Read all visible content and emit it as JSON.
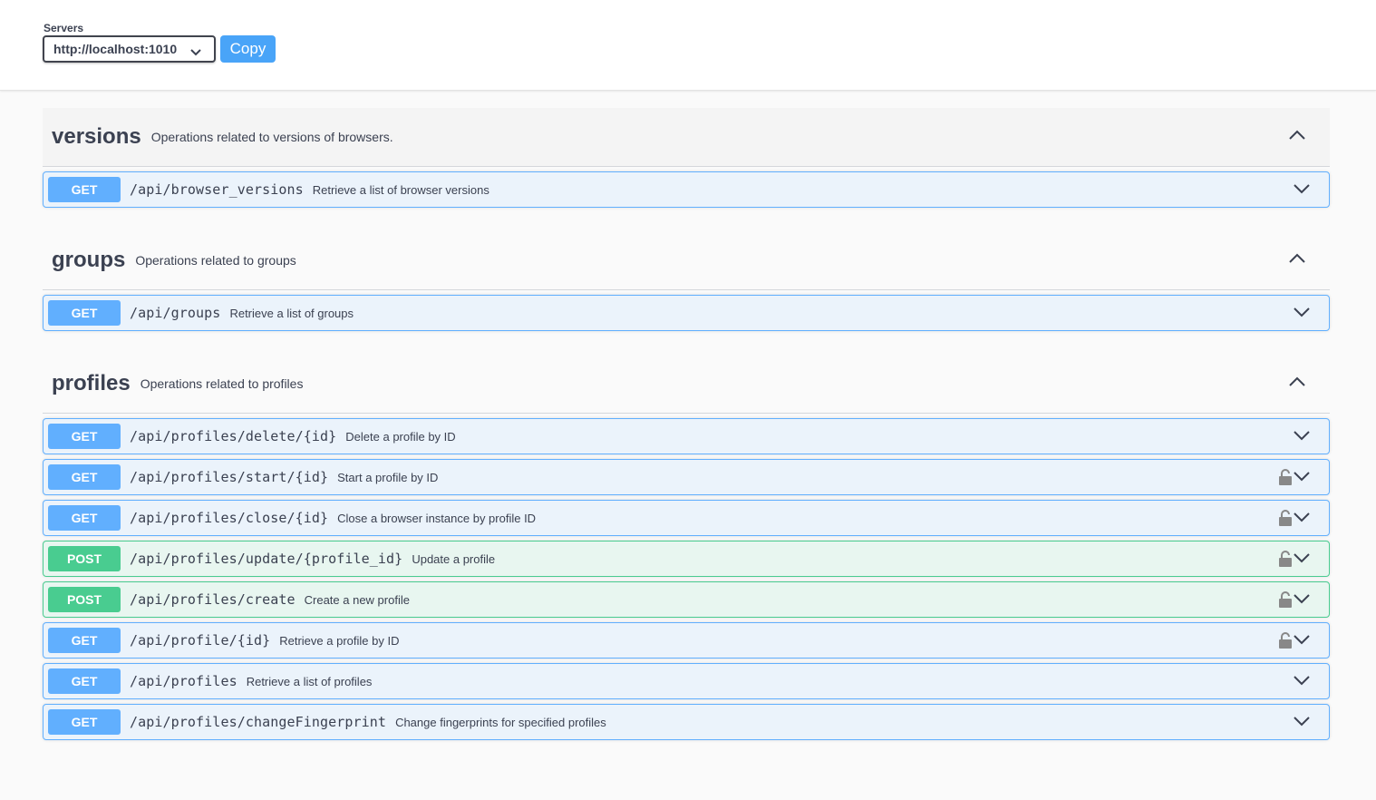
{
  "servers": {
    "label": "Servers",
    "selected": "http://localhost:1010",
    "copy_label": "Copy"
  },
  "icons": {
    "dropdown": "chevron-down-icon",
    "collapse": "chevron-up-icon",
    "expand": "chevron-down-icon",
    "lock": "lock-icon"
  },
  "colors": {
    "get": "#61affe",
    "post": "#49cc90",
    "copy_button": "#49a4f8"
  },
  "tags": [
    {
      "name": "versions",
      "description": "Operations related to versions of browsers.",
      "operations": [
        {
          "method": "GET",
          "path": "/api/browser_versions",
          "summary": "Retrieve a list of browser versions",
          "locked": false
        }
      ]
    },
    {
      "name": "groups",
      "description": "Operations related to groups",
      "operations": [
        {
          "method": "GET",
          "path": "/api/groups",
          "summary": "Retrieve a list of groups",
          "locked": false
        }
      ]
    },
    {
      "name": "profiles",
      "description": "Operations related to profiles",
      "operations": [
        {
          "method": "GET",
          "path": "/api/profiles/delete/{id}",
          "summary": "Delete a profile by ID",
          "locked": false
        },
        {
          "method": "GET",
          "path": "/api/profiles/start/{id}",
          "summary": "Start a profile by ID",
          "locked": true
        },
        {
          "method": "GET",
          "path": "/api/profiles/close/{id}",
          "summary": "Close a browser instance by profile ID",
          "locked": true
        },
        {
          "method": "POST",
          "path": "/api/profiles/update/{profile_id}",
          "summary": "Update a profile",
          "locked": true
        },
        {
          "method": "POST",
          "path": "/api/profiles/create",
          "summary": "Create a new profile",
          "locked": true
        },
        {
          "method": "GET",
          "path": "/api/profile/{id}",
          "summary": "Retrieve a profile by ID",
          "locked": true
        },
        {
          "method": "GET",
          "path": "/api/profiles",
          "summary": "Retrieve a list of profiles",
          "locked": false
        },
        {
          "method": "GET",
          "path": "/api/profiles/changeFingerprint",
          "summary": "Change fingerprints for specified profiles",
          "locked": false
        }
      ]
    }
  ]
}
